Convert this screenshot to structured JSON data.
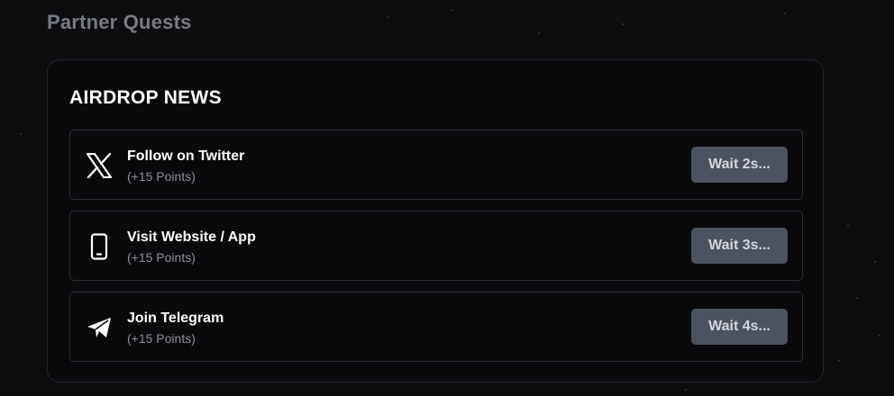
{
  "section_title": "Partner Quests",
  "card": {
    "title": "AIRDROP NEWS",
    "quests": [
      {
        "icon": "x-twitter-icon",
        "title": "Follow on Twitter",
        "points": "(+15 Points)",
        "button": "Wait 2s..."
      },
      {
        "icon": "smartphone-icon",
        "title": "Visit Website / App",
        "points": "(+15 Points)",
        "button": "Wait 3s..."
      },
      {
        "icon": "telegram-icon",
        "title": "Join Telegram",
        "points": "(+15 Points)",
        "button": "Wait 4s..."
      }
    ]
  },
  "colors": {
    "background": "#0d0d10",
    "card_border": "#23262e",
    "button_bg": "#4b5260",
    "muted_text": "#8b8f9a"
  }
}
